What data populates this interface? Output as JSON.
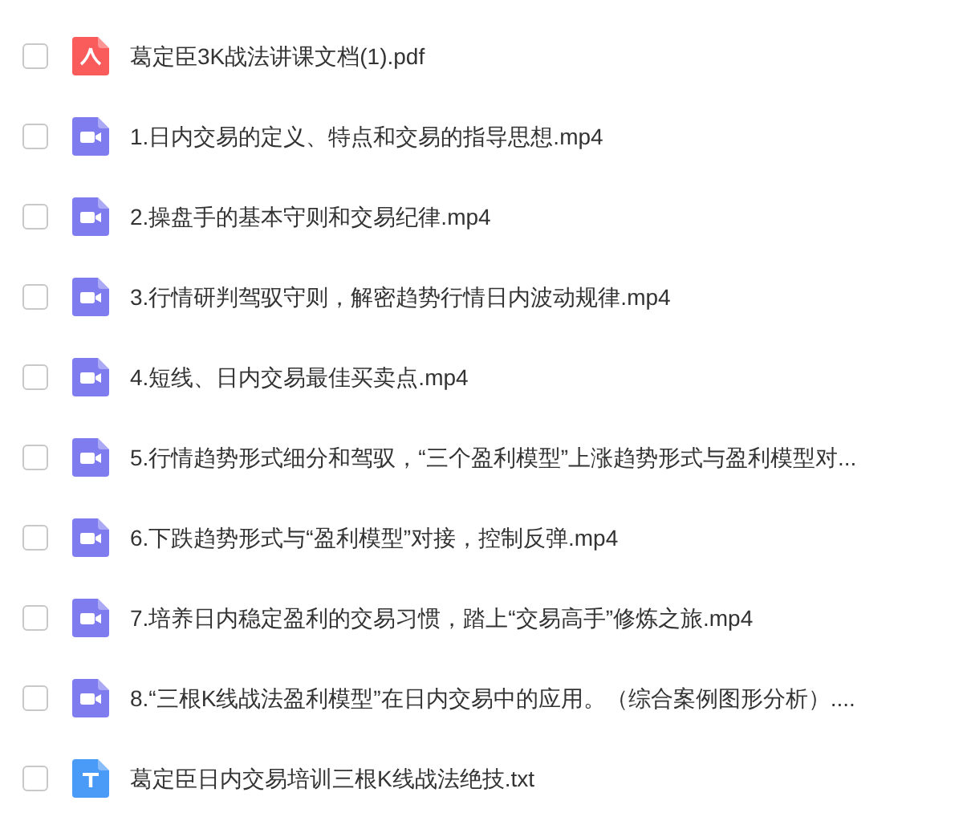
{
  "files": [
    {
      "kind": "pdf",
      "name": "葛定臣3K战法讲课文档(1).pdf",
      "checked": false
    },
    {
      "kind": "video",
      "name": "1.日内交易的定义、特点和交易的指导思想.mp4",
      "checked": false
    },
    {
      "kind": "video",
      "name": "2.操盘手的基本守则和交易纪律.mp4",
      "checked": false
    },
    {
      "kind": "video",
      "name": "3.行情研判驾驭守则，解密趋势行情日内波动规律.mp4",
      "checked": false
    },
    {
      "kind": "video",
      "name": "4.短线、日内交易最佳买卖点.mp4",
      "checked": false
    },
    {
      "kind": "video",
      "name": "5.行情趋势形式细分和驾驭，“三个盈利模型”上涨趋势形式与盈利模型对...",
      "checked": false
    },
    {
      "kind": "video",
      "name": "6.下跌趋势形式与“盈利模型”对接，控制反弹.mp4",
      "checked": false
    },
    {
      "kind": "video",
      "name": "7.培养日内稳定盈利的交易习惯，踏上“交易高手”修炼之旅.mp4",
      "checked": false
    },
    {
      "kind": "video",
      "name": "8.“三根K线战法盈利模型”在日内交易中的应用。（综合案例图形分析）....",
      "checked": false
    },
    {
      "kind": "text",
      "name": "葛定臣日内交易培训三根K线战法绝技.txt",
      "checked": false
    }
  ]
}
